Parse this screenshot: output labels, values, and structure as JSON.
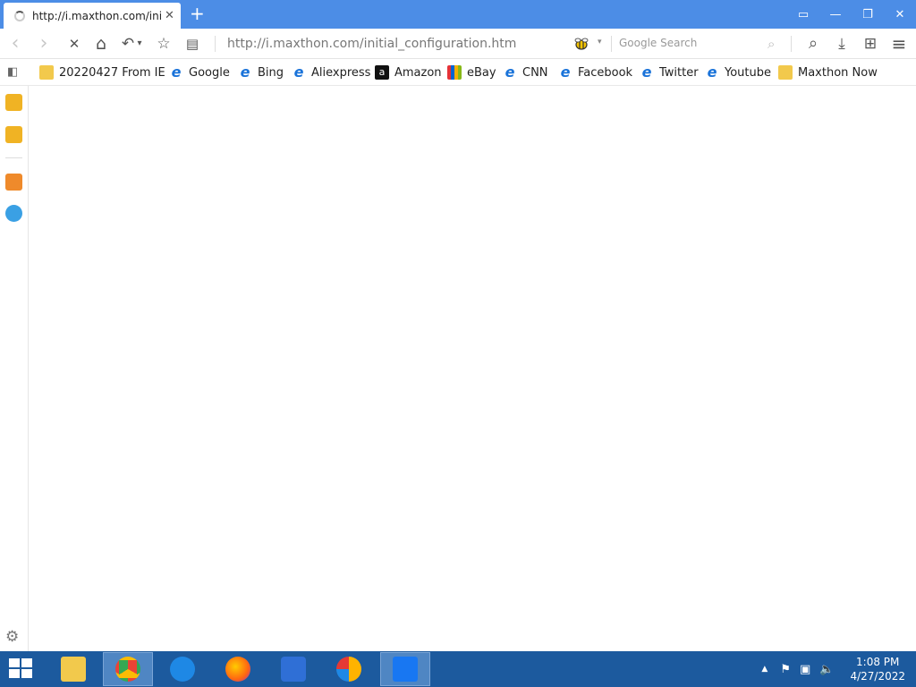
{
  "tab": {
    "title": "http://i.maxthon.com/init",
    "close_glyph": "✕",
    "new_tab_glyph": "+"
  },
  "window_controls": {
    "layout_glyph": "▭",
    "minimize_glyph": "—",
    "restore_glyph": "❐",
    "close_glyph": "✕"
  },
  "toolbar": {
    "back_glyph": "‹",
    "forward_glyph": "›",
    "stop_glyph": "✕",
    "home_glyph": "⌂",
    "undo_glyph": "↶",
    "undo_dropdown_glyph": "▾",
    "favorite_glyph": "☆",
    "reader_glyph": "▤",
    "url": "http://i.maxthon.com/initial_configuration.htm",
    "search_engine_dropdown": "▾",
    "search_placeholder": "Google Search",
    "search_icon": "⌕",
    "find_glyph": "⌕",
    "download_glyph": "⤓",
    "apps_glyph": "⊞",
    "menu_glyph": "≡"
  },
  "bookmarks": [
    {
      "label": "20220427 From IE",
      "icon": "folder-icon"
    },
    {
      "label": "Google",
      "icon": "ie-icon"
    },
    {
      "label": "Bing",
      "icon": "ie-icon"
    },
    {
      "label": "Aliexpress",
      "icon": "ie-icon"
    },
    {
      "label": "Amazon",
      "icon": "amazon-icon"
    },
    {
      "label": "eBay",
      "icon": "ebay-icon"
    },
    {
      "label": "CNN",
      "icon": "ie-icon"
    },
    {
      "label": "Facebook",
      "icon": "ie-icon"
    },
    {
      "label": "Twitter",
      "icon": "ie-icon"
    },
    {
      "label": "Youtube",
      "icon": "ie-icon"
    },
    {
      "label": "Maxthon Now",
      "icon": "maxthon-now-icon"
    }
  ],
  "bookmark_glyphs": {
    "ie": "e",
    "amazon": "a"
  },
  "sidebar": {
    "panel_toggle_glyph": "◧",
    "settings_glyph": "⚙"
  },
  "taskbar": {
    "apps": [
      "file-explorer",
      "chrome",
      "internet-explorer",
      "firefox",
      "arc",
      "avast-browser",
      "maxthon"
    ],
    "active_app": "chrome",
    "tray_arrow": "▲",
    "clock_time": "1:08 PM",
    "clock_date": "4/27/2022"
  },
  "colors": {
    "tab_strip": "#4c8de6",
    "taskbar": "#1c5a9e"
  }
}
